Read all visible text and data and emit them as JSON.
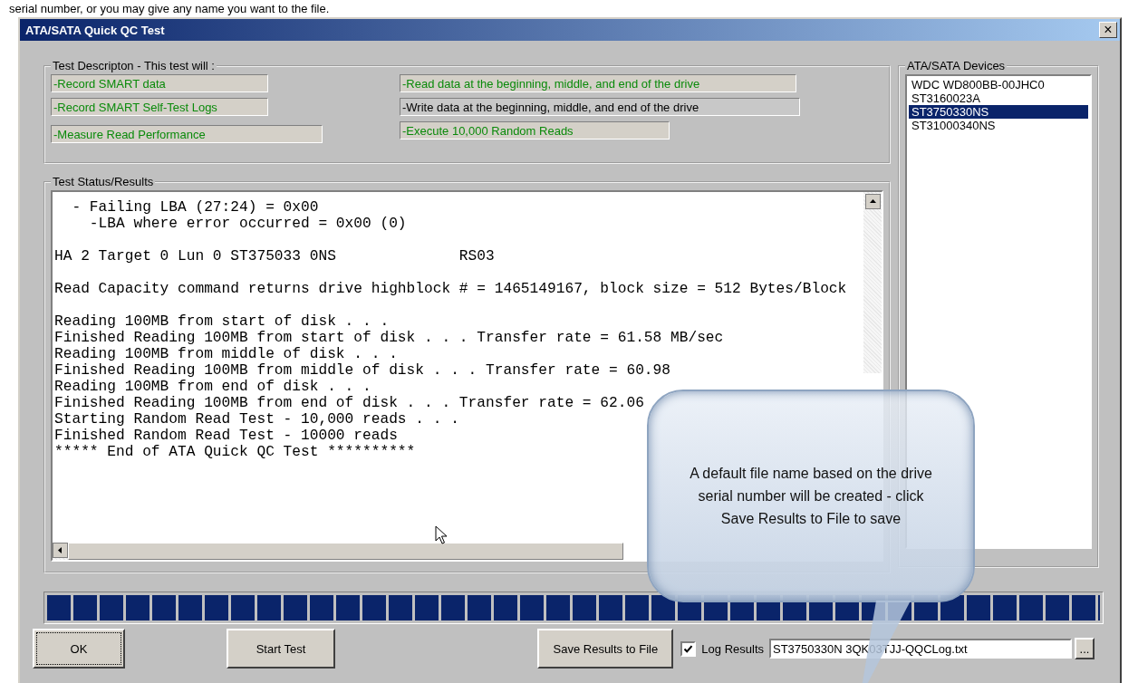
{
  "caption": "serial number, or you may give any name you want to the file.",
  "window": {
    "title": "ATA/SATA Quick QC Test",
    "close": "×"
  },
  "description": {
    "legend": "Test Descripton - This test will :",
    "left": [
      {
        "text": "-Record SMART data",
        "completed": true
      },
      {
        "text": "-Record SMART Self-Test Logs",
        "completed": true
      },
      {
        "text": "-Measure Read Performance",
        "completed": true
      }
    ],
    "right": [
      {
        "text": "-Read data at the beginning, middle, and end of the drive",
        "completed": true
      },
      {
        "text": "-Write data at the beginning, middle, and end of the drive",
        "completed": false
      },
      {
        "text": "-Execute 10,000 Random Reads",
        "completed": true
      }
    ]
  },
  "results": {
    "legend": "Test Status/Results",
    "blocks": [
      [
        "  - Failing LBA (27:24) = 0x00",
        "    -LBA where error occurred = 0x00 (0)"
      ],
      [
        "HA 2 Target 0 Lun 0 ST375033 0NS              RS03"
      ],
      [
        "Read Capacity command returns drive highblock # = 1465149167, block size = 512 Bytes/Block"
      ],
      [
        "Reading 100MB from start of disk . . .",
        "Finished Reading 100MB from start of disk . . . Transfer rate = 61.58 MB/sec",
        "Reading 100MB from middle of disk . . .",
        "Finished Reading 100MB from middle of disk . . . Transfer rate = 60.98",
        "Reading 100MB from end of disk . . .",
        "Finished Reading 100MB from end of disk . . . Transfer rate = 62.06",
        "Starting Random Read Test - 10,000 reads . . .",
        "Finished Random Read Test - 10000 reads",
        "***** End of ATA Quick QC Test **********"
      ]
    ]
  },
  "devices": {
    "legend": "ATA/SATA Devices",
    "items": [
      {
        "name": "WDC WD800BB-00JHC0",
        "selected": false
      },
      {
        "name": "ST3160023A",
        "selected": false
      },
      {
        "name": "ST3750330NS",
        "selected": true
      },
      {
        "name": "ST31000340NS",
        "selected": false
      }
    ]
  },
  "progress": {
    "level": 1.0
  },
  "buttons": {
    "ok": "OK",
    "start": "Start Test",
    "save": "Save Results to File",
    "browse": "..."
  },
  "log_results": {
    "label": "Log Results",
    "checked": true,
    "value": "ST3750330N 3QK03TJJ-QQCLog.txt"
  },
  "callout": {
    "text": "A default file name based on the drive serial number will be created - click Save Results to File to save"
  }
}
